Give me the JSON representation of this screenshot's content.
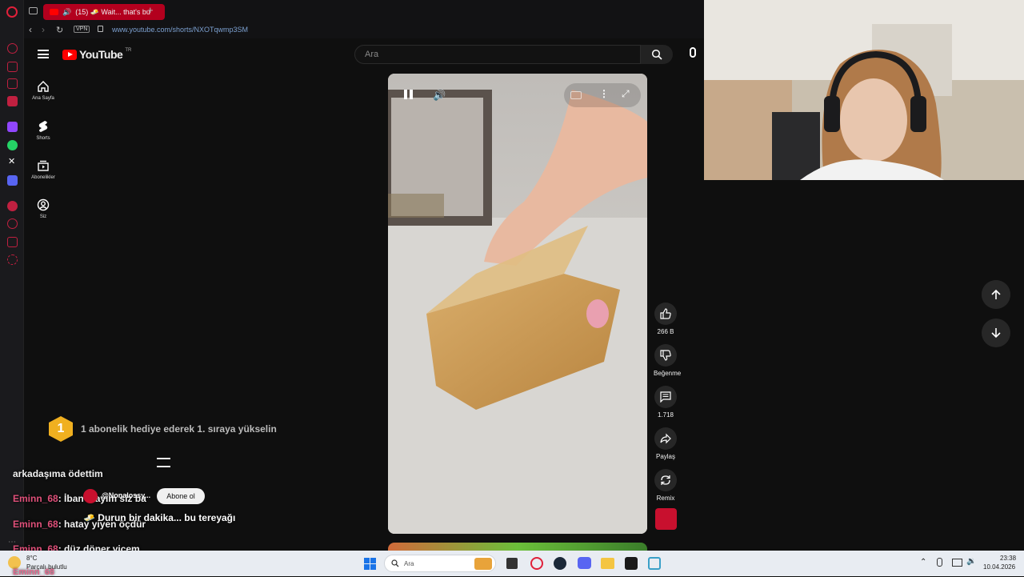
{
  "browser": {
    "tab_title": "(15) 🧈 Wait... that's bu",
    "vpn_label": "VPN",
    "url": "www.youtube.com/shorts/NXOTqwmp3SM"
  },
  "youtube": {
    "logo_text": "YouTube",
    "region": "TR",
    "search_placeholder": "Ara",
    "nav": [
      {
        "label": "Ana Sayfa",
        "icon": "home-icon"
      },
      {
        "label": "Shorts",
        "icon": "shorts-icon"
      },
      {
        "label": "Abonelikler",
        "icon": "subscriptions-icon"
      },
      {
        "label": "Siz",
        "icon": "user-icon"
      }
    ],
    "actions": {
      "like_count": "266 B",
      "dislike_label": "Beğenme",
      "comment_count": "1.718",
      "share_label": "Paylaş",
      "remix_label": "Remix"
    },
    "channel_handle": "@Nonalossy...",
    "subscribe_label": "Abone ol",
    "video_title": "Durun bir dakika... bu tereyağı"
  },
  "stream_overlay": {
    "rank_badge": "1",
    "rank_message": "1 abonelik hediye ederek 1. sıraya yükselin",
    "chat": [
      {
        "user": "",
        "text": "arkadaşıma ödettim"
      },
      {
        "user": "Eminn_68",
        "text": ": İban atayım siz ba"
      },
      {
        "user": "Eminn_68",
        "text": ": hatay yiyen öçdür"
      },
      {
        "user": "Eminn_68",
        "text": ": düz döner yicem"
      },
      {
        "user": "Eminn_68",
        "text": ""
      }
    ]
  },
  "taskbar": {
    "weather_temp": "8°C",
    "weather_desc": "Parçalı bulutlu",
    "search_placeholder": "Ara",
    "time": "23:38",
    "date": "10.04.2026"
  },
  "colors": {
    "youtube_red": "#ff0000",
    "opera_red": "#b3001e",
    "chat_user": "#e0507a"
  }
}
